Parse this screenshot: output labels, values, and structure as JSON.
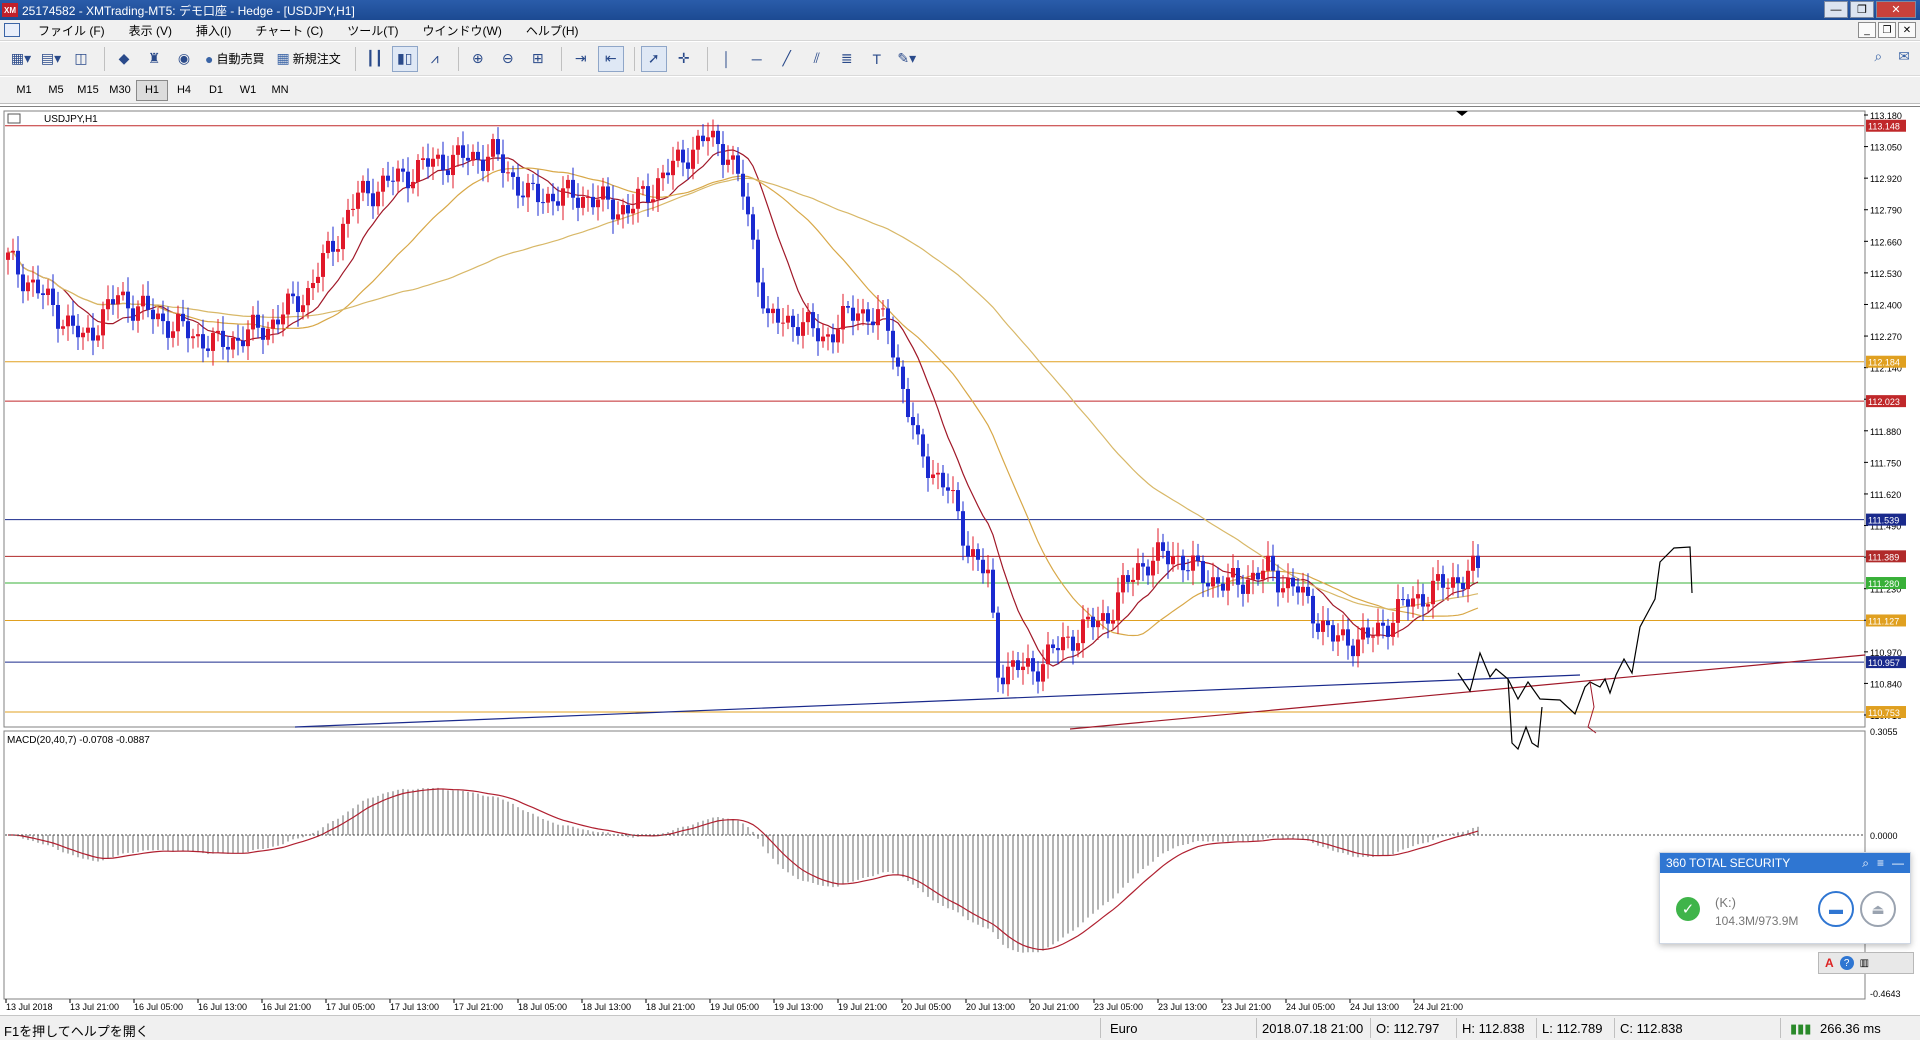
{
  "window": {
    "title": "25174582 - XMTrading-MT5: デモ口座 - Hedge - [USDJPY,H1]",
    "app_icon": "XM",
    "minimize": "—",
    "maximize": "❐",
    "close": "✕"
  },
  "menu": {
    "items": [
      "ファイル (F)",
      "表示 (V)",
      "挿入(I)",
      "チャート (C)",
      "ツール(T)",
      "ウインドウ(W)",
      "ヘルプ(H)"
    ]
  },
  "toolbar": {
    "auto_trading_label": "自動売買",
    "new_order_label": "新規注文"
  },
  "timeframes": [
    "M1",
    "M5",
    "M15",
    "M30",
    "H1",
    "H4",
    "D1",
    "W1",
    "MN"
  ],
  "active_timeframe": "H1",
  "chart": {
    "symbol_label": "USDJPY,H1",
    "macd_label": "MACD(20,40,7) -0.0708 -0.0887",
    "price_ticks": [
      "113.180",
      "113.050",
      "112.920",
      "112.790",
      "112.660",
      "112.530",
      "112.400",
      "112.270",
      "112.140",
      "112.010",
      "111.880",
      "111.750",
      "111.620",
      "111.490",
      "111.360",
      "111.230",
      "111.100",
      "110.970",
      "110.840",
      "110.710"
    ],
    "macd_ticks": [
      "0.3055",
      "0.0000",
      "-0.4643"
    ],
    "time_ticks": [
      "13 Jul 2018",
      "13 Jul 21:00",
      "16 Jul 05:00",
      "16 Jul 13:00",
      "16 Jul 21:00",
      "17 Jul 05:00",
      "17 Jul 13:00",
      "17 Jul 21:00",
      "18 Jul 05:00",
      "18 Jul 13:00",
      "18 Jul 21:00",
      "19 Jul 05:00",
      "19 Jul 13:00",
      "19 Jul 21:00",
      "20 Jul 05:00",
      "20 Jul 13:00",
      "20 Jul 21:00",
      "23 Jul 05:00",
      "23 Jul 13:00",
      "23 Jul 21:00",
      "24 Jul 05:00",
      "24 Jul 13:00",
      "24 Jul 21:00"
    ],
    "hlines": [
      {
        "price": 113.148,
        "label": "113.148",
        "color": "#c0282a"
      },
      {
        "price": 112.184,
        "label": "112.184",
        "color": "#e0a020"
      },
      {
        "price": 112.023,
        "label": "112.023",
        "color": "#c0282a"
      },
      {
        "price": 111.539,
        "label": "111.539",
        "color": "#1a2a8c"
      },
      {
        "price": 111.389,
        "label": "111.389",
        "color": "#b02a2a"
      },
      {
        "price": 111.28,
        "label": "111.280",
        "color": "#38b038"
      },
      {
        "price": 111.127,
        "label": "111.127",
        "color": "#e0a020"
      },
      {
        "price": 110.957,
        "label": "110.957",
        "color": "#1a2a8c"
      },
      {
        "price": 110.753,
        "label": "110.753",
        "color": "#e0a020"
      }
    ],
    "colors": {
      "bull": "#e0182a",
      "bear": "#1a2ad0",
      "ma_fast": "#a01828",
      "ma_mid": "#d8a848",
      "ma_slow": "#d8b868",
      "macd_hist": "#b4b4b4",
      "macd_signal": "#b02030"
    }
  },
  "status": {
    "help": "F1を押してヘルプを開く",
    "profile": "Euro",
    "datetime": "2018.07.18 21:00",
    "open": "O: 112.797",
    "high": "H: 112.838",
    "low": "L: 112.789",
    "close": "C: 112.838",
    "ping": "266.36 ms"
  },
  "security": {
    "title": "360 TOTAL SECURITY",
    "drive": "(K:)",
    "usage": "104.3M/973.9M"
  }
}
